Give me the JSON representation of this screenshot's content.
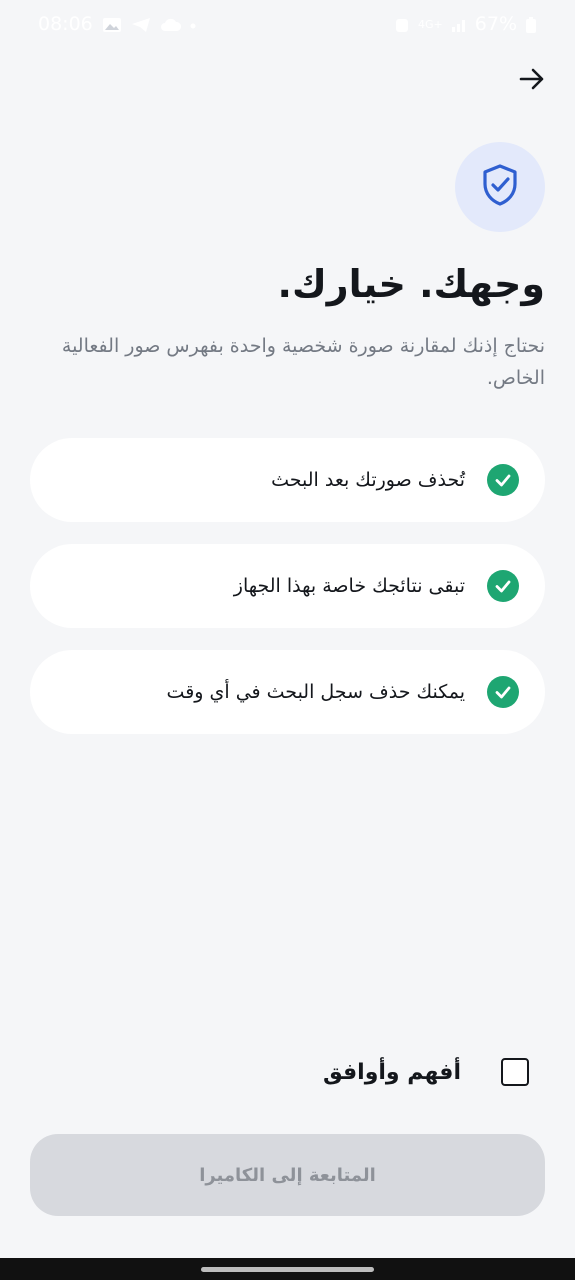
{
  "status_bar": {
    "time": "08:06",
    "network": "4G+",
    "battery": "67%",
    "left_icons": [
      "gallery-icon",
      "telegram-icon",
      "cloud-icon",
      "dot-icon"
    ],
    "right_icons": [
      "alarm-icon",
      "signal-icon",
      "battery-icon"
    ]
  },
  "header": {
    "back_icon": "arrow-right-icon",
    "badge_icon": "shield-check-icon",
    "accent_color": "#2f5fd0"
  },
  "title": "وجهك. خيارك.",
  "subtitle": "نحتاج إذنك لمقارنة صورة شخصية واحدة بفهرس صور الفعالية الخاص.",
  "features": [
    {
      "icon": "check-circle-icon",
      "text": "تُحذف صورتك بعد البحث"
    },
    {
      "icon": "check-circle-icon",
      "text": "تبقى نتائجك خاصة بهذا الجهاز"
    },
    {
      "icon": "check-circle-icon",
      "text": "يمكنك حذف سجل البحث في أي وقت"
    }
  ],
  "check_color": "#1ea672",
  "agreement": {
    "label": "أفهم وأوافق",
    "checked": false
  },
  "continue_button": {
    "label": "المتابعة إلى الكاميرا",
    "enabled": false
  }
}
